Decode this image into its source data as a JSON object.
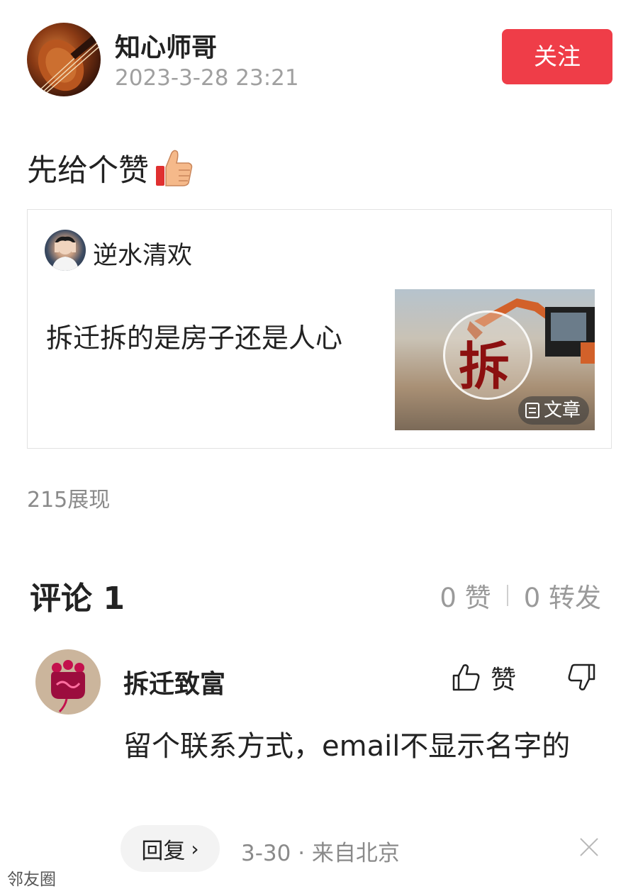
{
  "post": {
    "author_name": "知心师哥",
    "timestamp": "2023-3-28 23:21",
    "follow_label": "关注",
    "text": "先给个赞",
    "emoji": "thumbs-up-icon",
    "impressions": "215展现"
  },
  "quoted_article": {
    "author_name": "逆水清欢",
    "title": "拆迁拆的是房子还是人心",
    "thumbnail_char": "拆",
    "tag_label": "文章",
    "tag_icon": "document-icon"
  },
  "comments_section": {
    "title": "评论 1",
    "likes": "0 赞",
    "reposts": "0 转发"
  },
  "comment": {
    "author_name": "拆迁致富",
    "like_label": "赞",
    "text": "留个联系方式，email不显示名字的",
    "reply_label": "回复",
    "meta": "3-30 · 来自北京"
  },
  "watermark": "邻友圈",
  "colors": {
    "follow_button": "#ef3d48",
    "secondary_text": "#8a8a8a",
    "primary_text": "#222222"
  }
}
